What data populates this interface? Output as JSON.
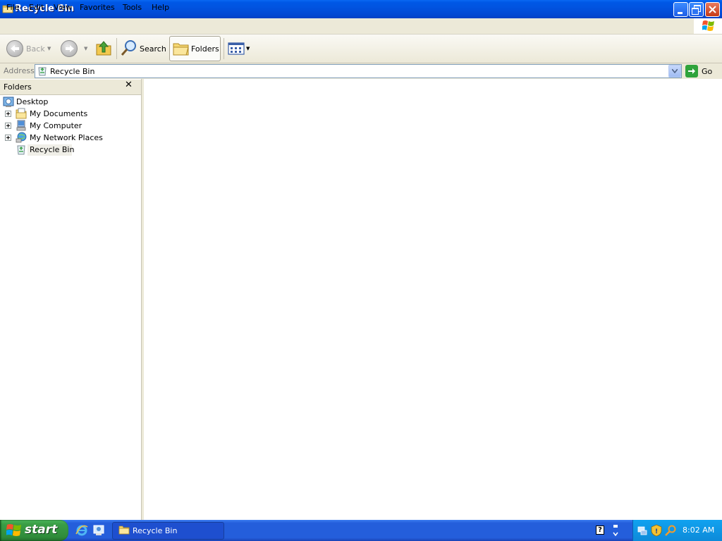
{
  "window": {
    "title": "Recycle Bin"
  },
  "menu": {
    "items": [
      "File",
      "Edit",
      "View",
      "Favorites",
      "Tools",
      "Help"
    ]
  },
  "toolbar": {
    "back_label": "Back",
    "search_label": "Search",
    "folders_label": "Folders"
  },
  "address": {
    "label": "Address",
    "value": "Recycle Bin",
    "go_label": "Go"
  },
  "folders_pane": {
    "title": "Folders",
    "close_glyph": "✕",
    "tree": [
      {
        "label": "Desktop",
        "icon": "desktop-icon"
      },
      {
        "label": "My Documents",
        "icon": "my-documents-icon",
        "expandable": true
      },
      {
        "label": "My Computer",
        "icon": "my-computer-icon",
        "expandable": true
      },
      {
        "label": "My Network Places",
        "icon": "network-places-icon",
        "expandable": true
      },
      {
        "label": "Recycle Bin",
        "icon": "recycle-bin-icon",
        "selected": true
      }
    ]
  },
  "taskbar": {
    "start_label": "start",
    "task_label": "Recycle Bin",
    "clock": "8:02 AM",
    "help_glyph": "?"
  },
  "colors": {
    "titlebar": "#0153e0",
    "taskbar": "#245edb",
    "start_button": "#3a9e46",
    "tray": "#0d8ad9",
    "window_bg": "#ece9d8"
  }
}
